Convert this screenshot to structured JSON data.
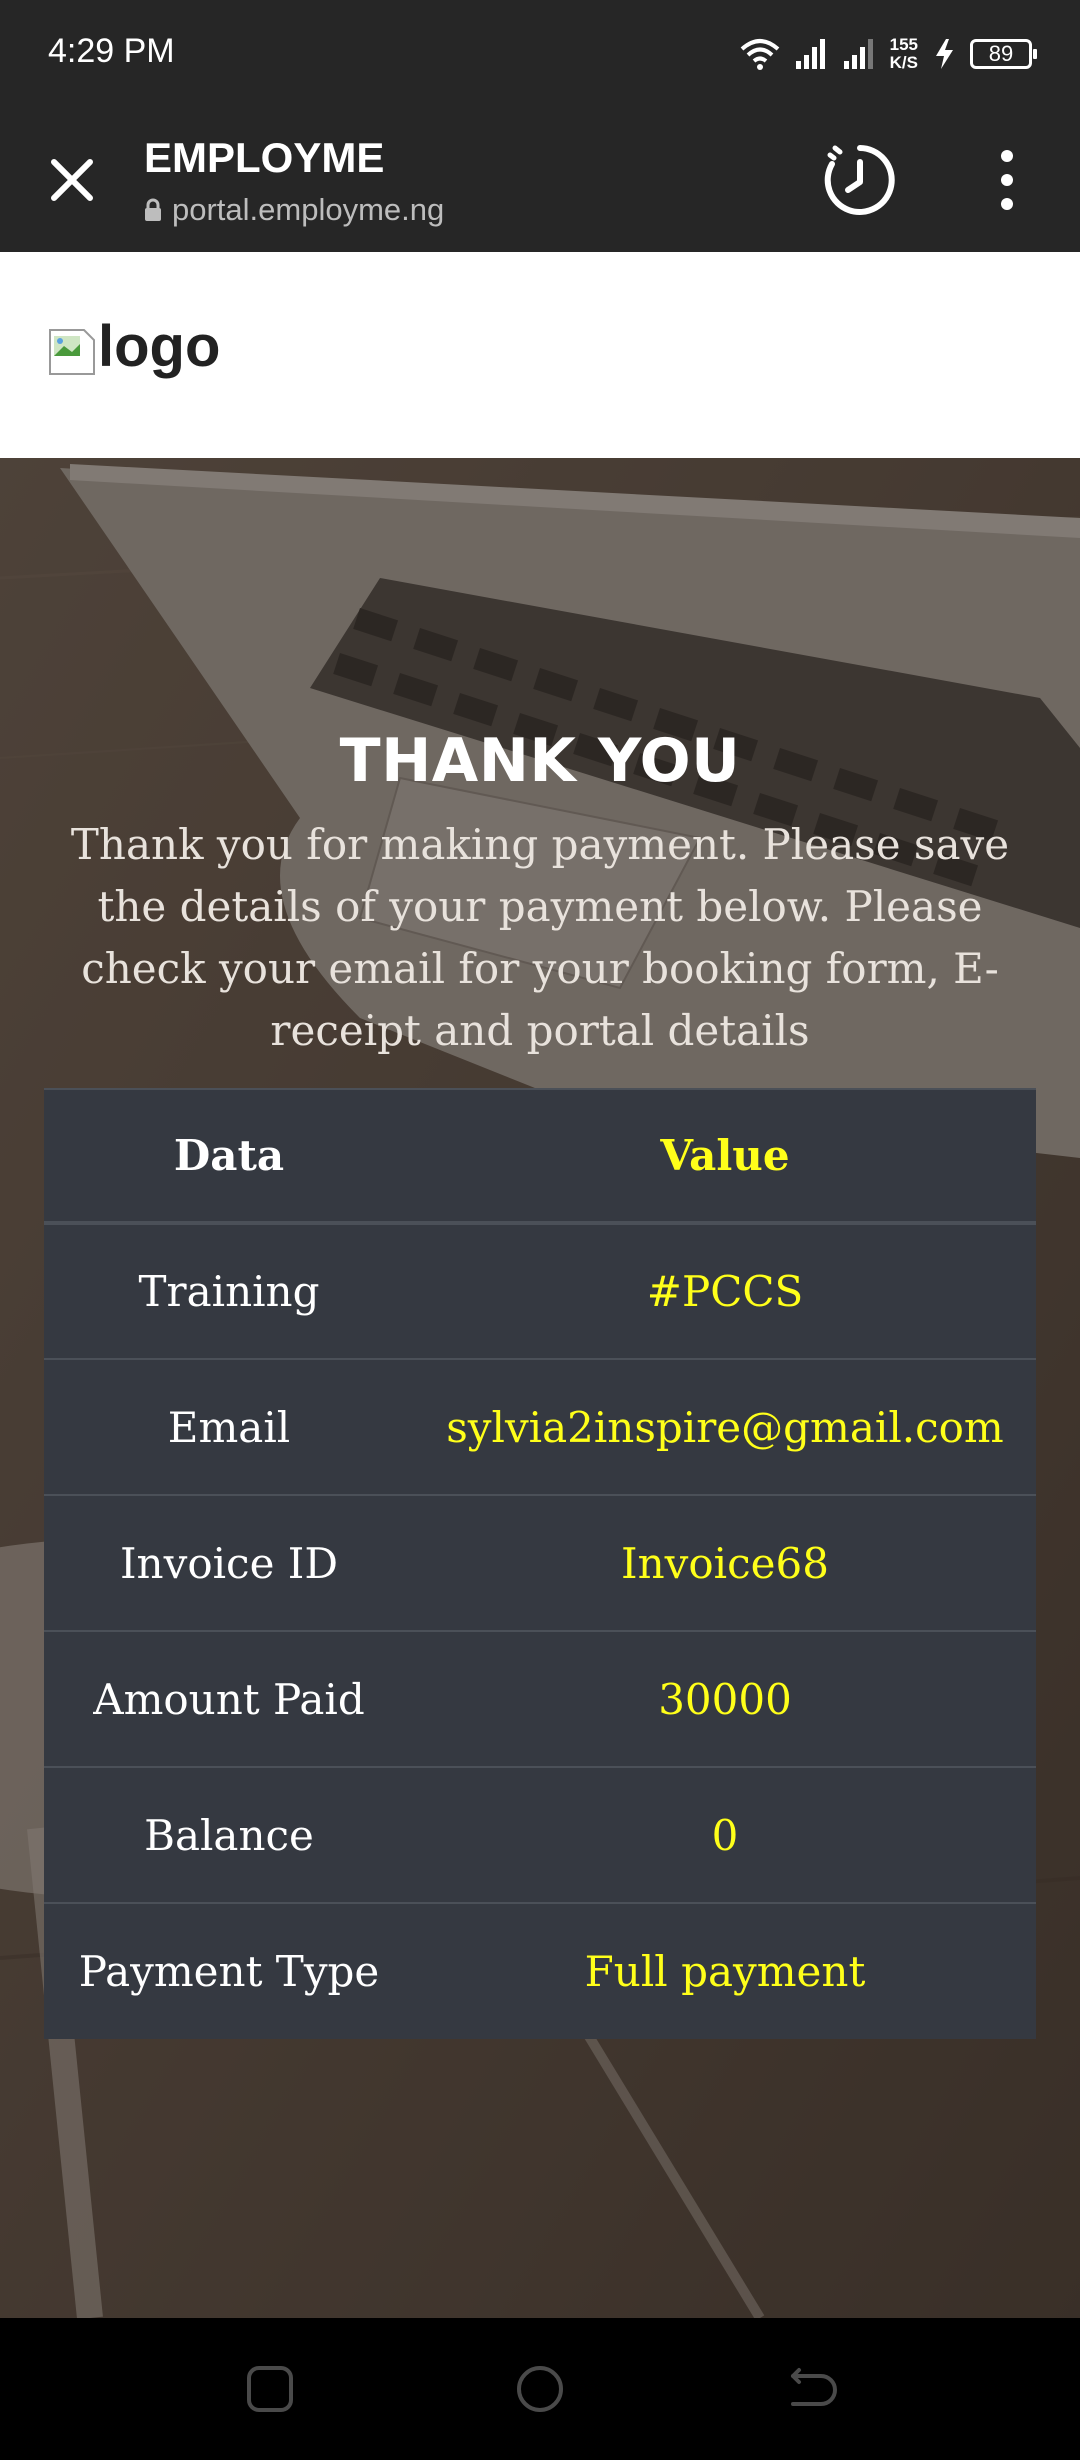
{
  "status_bar": {
    "time": "4:29 PM",
    "net_speed_value": "155",
    "net_speed_unit": "K/S",
    "battery": "89",
    "icons": [
      "wifi-icon",
      "signal-icon",
      "signal-icon",
      "charging-icon",
      "battery-icon"
    ]
  },
  "browser": {
    "title": "EMPLOYME",
    "url": "portal.employme.ng",
    "icons": [
      "close-icon",
      "lock-icon",
      "history-icon",
      "more-vert-icon"
    ]
  },
  "logo": {
    "alt": "logo"
  },
  "hero": {
    "title": "THANK YOU",
    "message": "Thank you for making payment. Please save the details of your payment below. Please check your email for your booking form, E-receipt and portal details"
  },
  "table": {
    "headers": {
      "data": "Data",
      "value": "Value"
    },
    "rows": [
      {
        "data": "Training",
        "value": "#PCCS"
      },
      {
        "data": "Email",
        "value": "sylvia2inspire@gmail.com"
      },
      {
        "data": "Invoice ID",
        "value": "Invoice68"
      },
      {
        "data": "Amount Paid",
        "value": "30000"
      },
      {
        "data": "Balance",
        "value": "0"
      },
      {
        "data": "Payment Type",
        "value": "Full payment"
      }
    ]
  },
  "nav_bar": {
    "icons": [
      "recents-icon",
      "home-icon",
      "back-icon"
    ]
  },
  "colors": {
    "table_bg": "#353941",
    "value_text": "#ffff1a",
    "browser_bar": "#262626"
  }
}
